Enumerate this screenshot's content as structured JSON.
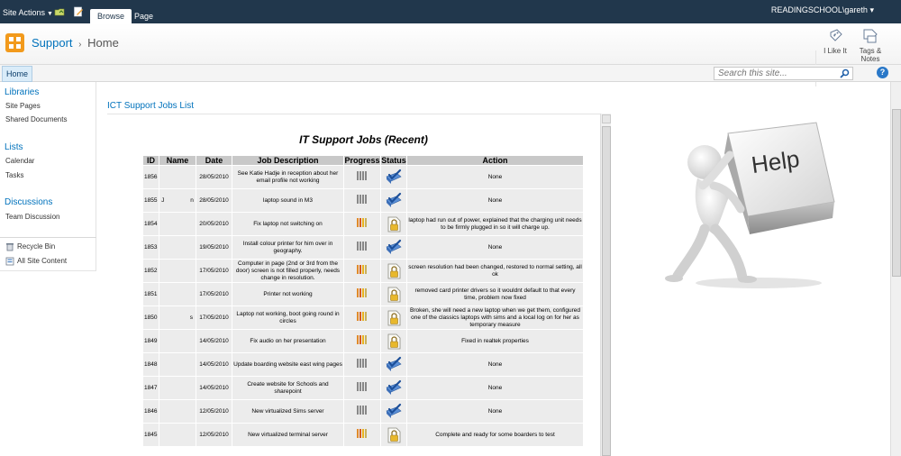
{
  "ribbon": {
    "site_actions": "Site Actions",
    "tabs": [
      {
        "label": "Browse"
      },
      {
        "label": "Page"
      }
    ],
    "user": "READINGSCHOOL\\gareth",
    "user_caret": "▾"
  },
  "title_area": {
    "site": "Support",
    "separator": "›",
    "current": "Home",
    "i_like_it": "I Like It",
    "tags_line1": "Tags &",
    "tags_line2": "Notes"
  },
  "top_nav": {
    "home": "Home",
    "search_placeholder": "Search this site...",
    "help": "?"
  },
  "left_nav": {
    "libraries": "Libraries",
    "site_pages": "Site Pages",
    "shared_documents": "Shared Documents",
    "lists": "Lists",
    "calendar": "Calendar",
    "tasks": "Tasks",
    "discussions": "Discussions",
    "team_discussion": "Team Discussion",
    "recycle_bin": "Recycle Bin",
    "all_site_content": "All Site Content"
  },
  "list_title": "ICT Support Jobs List",
  "jobs": {
    "heading": "IT Support Jobs (Recent)",
    "columns": [
      "ID",
      "Name",
      "Date",
      "Job Description",
      "Progress",
      "Status",
      "Action"
    ],
    "rows": [
      {
        "id": "1856",
        "name": "",
        "date": "28/05/2010",
        "desc": "See Katie Hadje in reception about her email profile not working",
        "progress": "complete",
        "status": "done",
        "action": "None"
      },
      {
        "id": "1855",
        "name": "J                n",
        "date": "28/05/2010",
        "desc": "laptop sound in M3",
        "progress": "complete",
        "status": "done",
        "action": "None"
      },
      {
        "id": "1854",
        "name": "",
        "date": "20/05/2010",
        "desc": "Fix laptop not switching on",
        "progress": "in-progress",
        "status": "pending",
        "action": "laptop had run out of power, explained that the charging unit needs to be firmly plugged in so it will charge up."
      },
      {
        "id": "1853",
        "name": "",
        "date": "19/05/2010",
        "desc": "Install colour printer for him over in geography.",
        "progress": "complete",
        "status": "done",
        "action": "None"
      },
      {
        "id": "1852",
        "name": "",
        "date": "17/05/2010",
        "desc": "Computer in page (2nd or 3rd from the door) screen is not filled properly, needs change in resolution.",
        "progress": "in-progress",
        "status": "pending",
        "action": "screen resolution had been changed, restored to normal setting, all ok"
      },
      {
        "id": "1851",
        "name": "",
        "date": "17/05/2010",
        "desc": "Printer not working",
        "progress": "in-progress",
        "status": "pending",
        "action": "removed card printer drivers so it wouldnt default to that every time, problem now fixed"
      },
      {
        "id": "1850",
        "name": "                 s",
        "date": "17/05/2010",
        "desc": "Laptop not working, boot going round in circles",
        "progress": "in-progress",
        "status": "pending",
        "action": "Broken, she will need a new laptop when we get them, configured one of the classics laptops with sims and a local log on for her as temporary measure"
      },
      {
        "id": "1849",
        "name": "",
        "date": "14/05/2010",
        "desc": "Fix audio on her presentation",
        "progress": "in-progress",
        "status": "pending",
        "action": "Fixed in realtek properties"
      },
      {
        "id": "1848",
        "name": "",
        "date": "14/05/2010",
        "desc": "Update boarding website east wing pages",
        "progress": "complete",
        "status": "done",
        "action": "None"
      },
      {
        "id": "1847",
        "name": "",
        "date": "14/05/2010",
        "desc": "Create website for Schools and sharepoint",
        "progress": "complete",
        "status": "done",
        "action": "None"
      },
      {
        "id": "1846",
        "name": "",
        "date": "12/05/2010",
        "desc": "New virtualized Sims server",
        "progress": "complete",
        "status": "done",
        "action": "None"
      },
      {
        "id": "1845",
        "name": "",
        "date": "12/05/2010",
        "desc": "New virtualized terminal server",
        "progress": "in-progress",
        "status": "pending",
        "action": "Complete and ready for some boarders to test"
      }
    ]
  },
  "help_image": {
    "text": "Help"
  },
  "colors": {
    "ribbon": "#21374c",
    "link": "#0072bc",
    "header_cell": "#c8c8c8",
    "row_cell": "#ececec"
  }
}
